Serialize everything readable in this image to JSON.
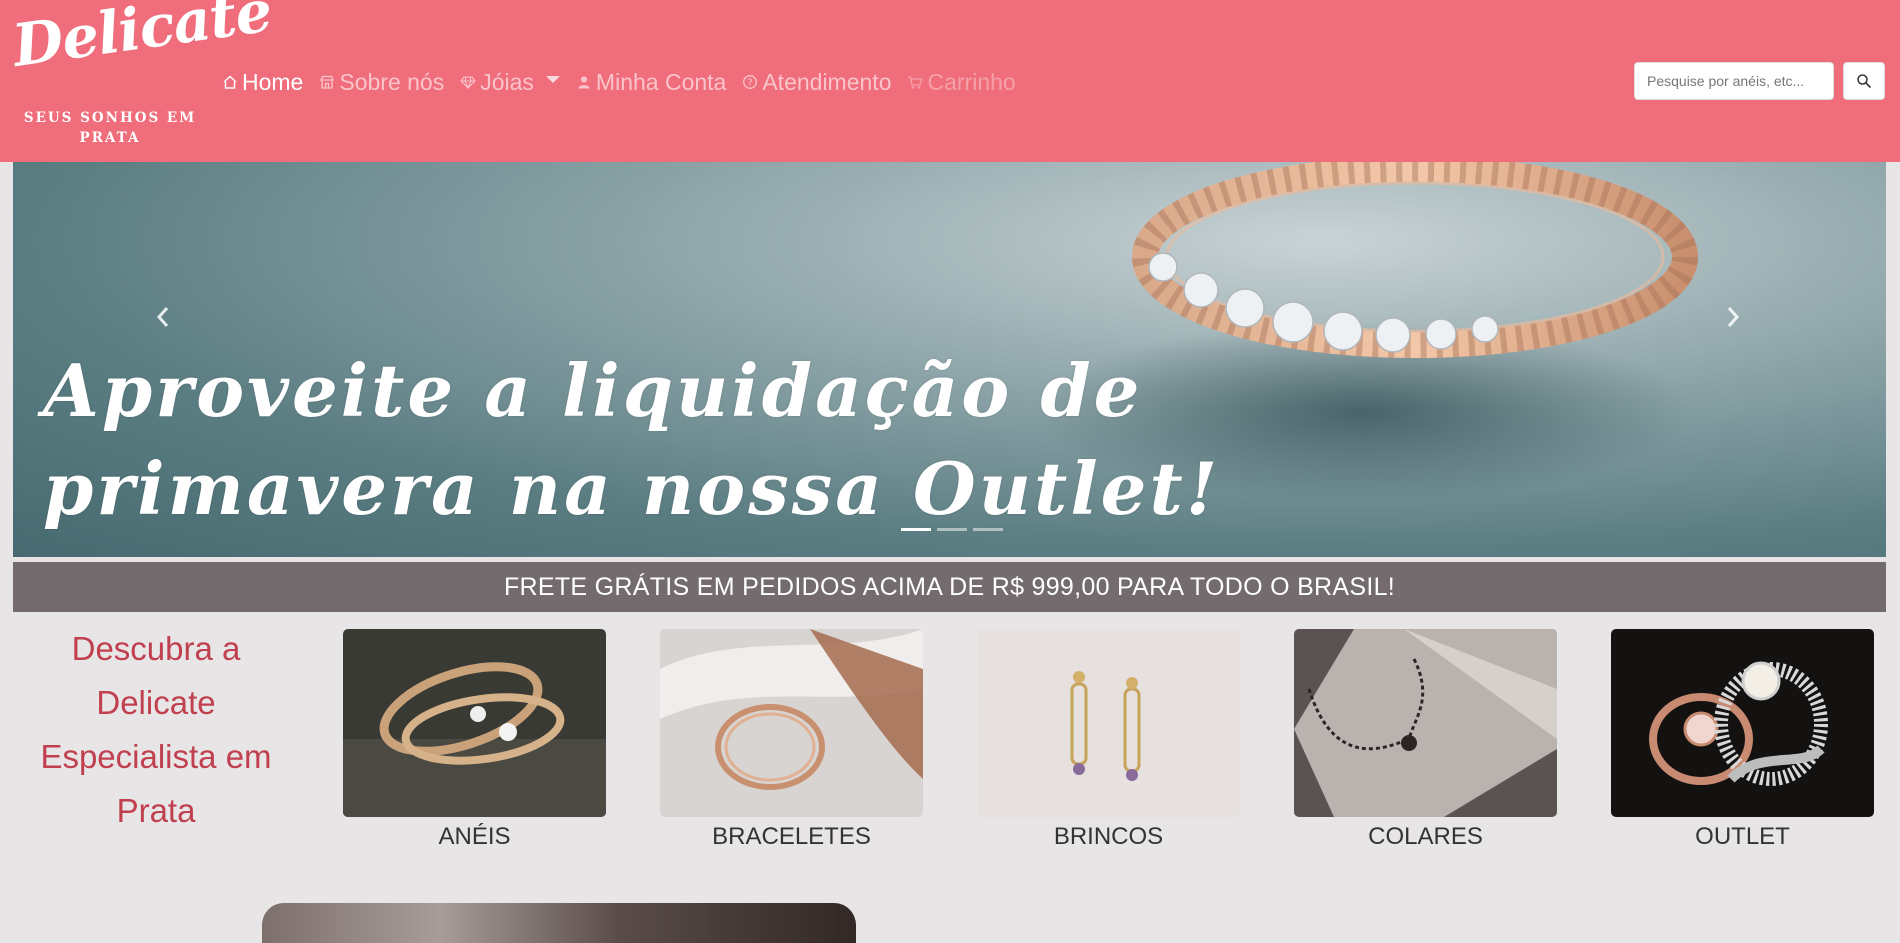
{
  "brand": {
    "name": "Delicate",
    "tagline": "SEUS SONHOS EM PRATA"
  },
  "nav": {
    "items": [
      {
        "label": "Home",
        "icon": "home-icon",
        "state": "active"
      },
      {
        "label": "Sobre nós",
        "icon": "store-icon",
        "state": "normal"
      },
      {
        "label": "Jóias",
        "icon": "diamond-icon",
        "state": "dropdown"
      },
      {
        "label": "Minha Conta",
        "icon": "user-icon",
        "state": "normal"
      },
      {
        "label": "Atendimento",
        "icon": "help-circle-icon",
        "state": "normal"
      },
      {
        "label": "Carrinho",
        "icon": "cart-icon",
        "state": "disabled"
      }
    ]
  },
  "search": {
    "placeholder": "Pesquise por anéis, etc...",
    "button_icon": "search-icon"
  },
  "carousel": {
    "caption_line1": "Aproveite a liquidação de",
    "caption_line2": "primavera na nossa Outlet!",
    "slide_count": 3,
    "active_slide": 1,
    "prev_icon": "chevron-left-icon",
    "next_icon": "chevron-right-icon"
  },
  "shipping_banner": "FRETE GRÁTIS EM PEDIDOS ACIMA DE R$ 999,00 PARA TODO O BRASIL!",
  "discover": {
    "line1": "Descubra a Delicate",
    "line2": "Especialista em",
    "line3": "Prata"
  },
  "categories": [
    {
      "label": "ANÉIS"
    },
    {
      "label": "BRACELETES"
    },
    {
      "label": "BRINCOS"
    },
    {
      "label": "COLARES"
    },
    {
      "label": "OUTLET"
    }
  ],
  "colors": {
    "navbar": "#f06d7c",
    "banner": "#736b6d",
    "accent_text": "#c1404f",
    "background": "#e8e5e6"
  }
}
